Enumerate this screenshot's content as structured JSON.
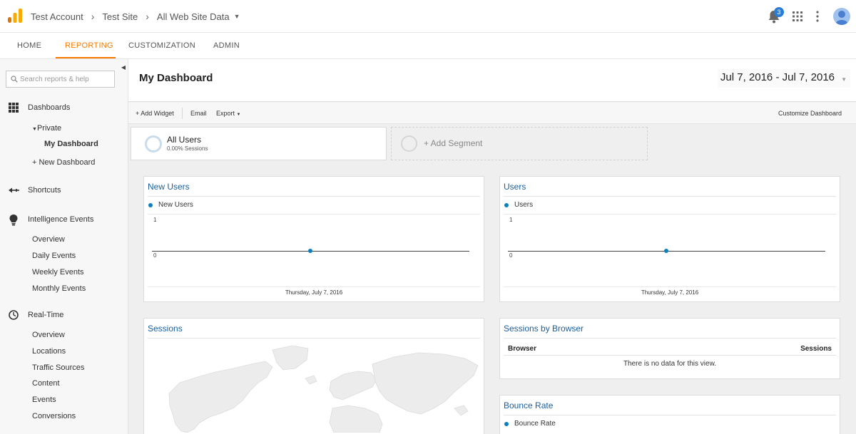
{
  "header": {
    "breadcrumbs": [
      "Test Account",
      "Test Site",
      "All Web Site Data"
    ],
    "notification_count": "3",
    "icons": {
      "logo": "analytics-logo",
      "bell": "bell-icon",
      "apps": "apps-grid-icon",
      "more": "more-vert-icon",
      "avatar": "avatar"
    },
    "colors": {
      "logo_orange": "#f9ab00",
      "logo_dark": "#e37400",
      "badge": "#2b7cd3"
    }
  },
  "nav": {
    "tabs": [
      {
        "label": "HOME",
        "active": false
      },
      {
        "label": "REPORTING",
        "active": true
      },
      {
        "label": "CUSTOMIZATION",
        "active": false
      },
      {
        "label": "ADMIN",
        "active": false
      }
    ],
    "accent": "#f57c00"
  },
  "sidebar": {
    "search_placeholder": "Search reports & help",
    "sections": [
      {
        "label": "Dashboards",
        "icon": "dashboard-grid-icon"
      },
      {
        "label": "Shortcuts",
        "icon": "shortcut-arrow-icon"
      },
      {
        "label": "Intelligence Events",
        "icon": "lightbulb-icon"
      },
      {
        "label": "Real-Time",
        "icon": "clock-icon"
      }
    ],
    "dashboards": {
      "private": "Private",
      "my_dashboard": "My Dashboard",
      "new_dashboard": "+ New Dashboard"
    },
    "intelligence_items": [
      "Overview",
      "Daily Events",
      "Weekly Events",
      "Monthly Events"
    ],
    "realtime_items": [
      "Overview",
      "Locations",
      "Traffic Sources",
      "Content",
      "Events",
      "Conversions"
    ]
  },
  "main": {
    "title": "My Dashboard",
    "date_range": "Jul 7, 2016 - Jul 7, 2016",
    "toolbar": {
      "add_widget": "+ Add Widget",
      "email": "Email",
      "export": "Export",
      "customize": "Customize Dashboard"
    },
    "segment": {
      "title": "All Users",
      "sub": "0.00% Sessions",
      "add": "+ Add Segment"
    },
    "widgets": {
      "new_users": {
        "title": "New Users",
        "legend": "New Users",
        "y_top": "1",
        "y_bottom": "0",
        "x_label": "Thursday, July 7, 2016",
        "value": 0
      },
      "users": {
        "title": "Users",
        "legend": "Users",
        "y_top": "1",
        "y_bottom": "0",
        "x_label": "Thursday, July 7, 2016",
        "value": 0
      },
      "sessions": {
        "title": "Sessions"
      },
      "sessions_by_browser": {
        "title": "Sessions by Browser",
        "col1": "Browser",
        "col2": "Sessions",
        "empty": "There is no data for this view."
      },
      "bounce_rate": {
        "title": "Bounce Rate",
        "legend": "Bounce Rate"
      }
    },
    "colors": {
      "widget_title": "#1a5e9e",
      "series": "#0a7fc2"
    }
  }
}
